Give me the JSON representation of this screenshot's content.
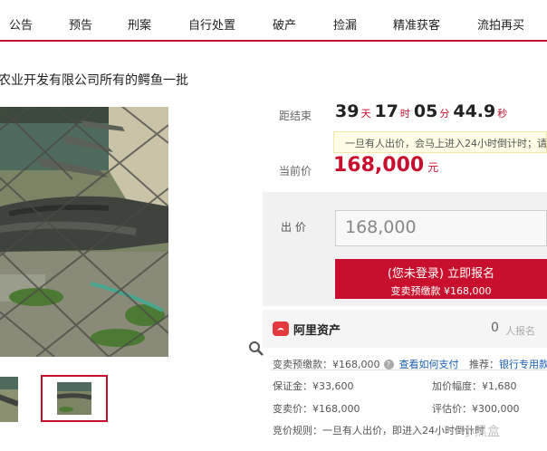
{
  "nav": [
    "公告",
    "预告",
    "刑案",
    "自行处置",
    "破产",
    "捡漏",
    "精准获客",
    "流拍再买"
  ],
  "title": "农业开发有限公司所有的鳄鱼一批",
  "countdown": {
    "label": "距结束",
    "days": "39",
    "days_unit": "天",
    "hours": "17",
    "hours_unit": "时",
    "minutes": "05",
    "minutes_unit": "分",
    "seconds": "44.9",
    "seconds_unit": "秒"
  },
  "notice": "一旦有人出价，会马上进入24小时倒计时；请",
  "current_price": {
    "label": "当前价",
    "value": "168,000",
    "unit": "元"
  },
  "bid": {
    "label": "出 价",
    "value": "168,000"
  },
  "signup_button": {
    "main": "(您未登录) 立即报名",
    "sub": "变卖预缴款 ¥168,000"
  },
  "ali": {
    "name": "阿里资产",
    "count": "0",
    "count_label": "人报名"
  },
  "details": {
    "deposit_label": "变卖预缴款：",
    "deposit_value": "¥168,000",
    "how_to_pay": "查看如何支付",
    "recommend_label": "推荐：",
    "recommend_link": "银行专用款",
    "bond": "保证金：¥33,600",
    "increment": "加价幅度：¥1,680",
    "sale_price": "变卖价：¥168,000",
    "valuation": "评估价：¥300,000",
    "rule": "竞价规则：一旦有人出价，即进入24小时倒计时"
  },
  "watermark": "小黑盒",
  "colors": {
    "accent": "#c8102e",
    "link": "#1a5fb4",
    "notice_bg": "#fffde6"
  },
  "icons": [
    "magnifier-icon",
    "help-icon",
    "ali-logo-icon"
  ]
}
